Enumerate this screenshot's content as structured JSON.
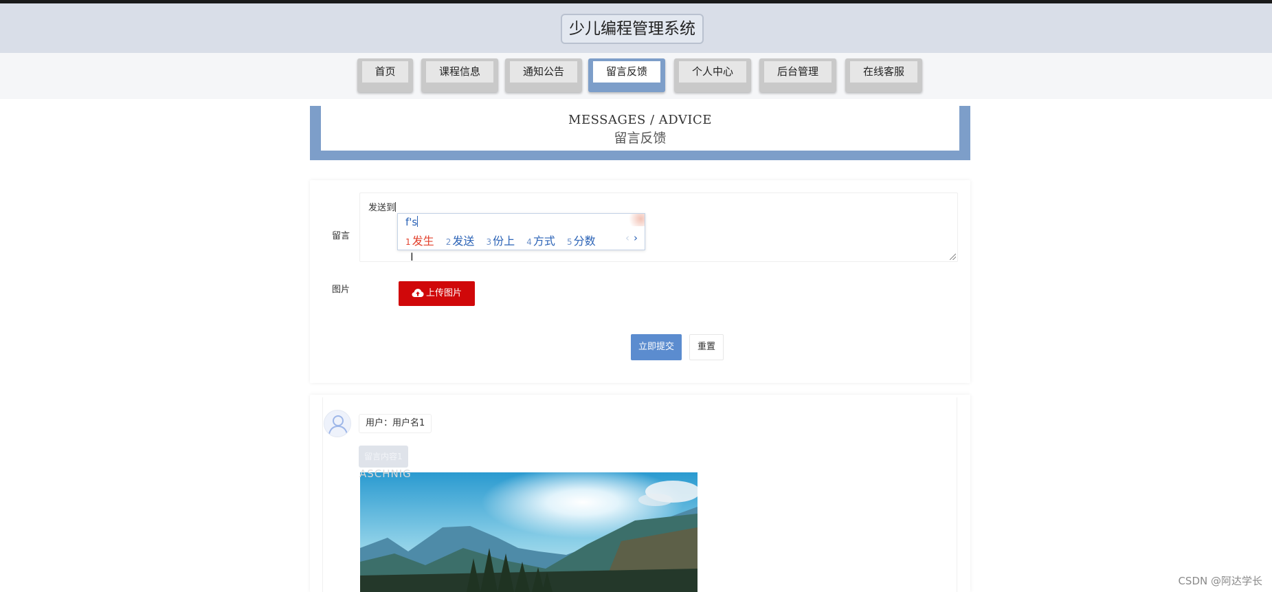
{
  "header": {
    "title": "少儿编程管理系统"
  },
  "nav": {
    "items": [
      {
        "label": "首页",
        "active": false
      },
      {
        "label": "课程信息",
        "active": false
      },
      {
        "label": "通知公告",
        "active": false
      },
      {
        "label": "留言反馈",
        "active": true
      },
      {
        "label": "个人中心",
        "active": false
      },
      {
        "label": "后台管理",
        "active": false
      },
      {
        "label": "在线客服",
        "active": false
      }
    ]
  },
  "banner": {
    "title_en": "MESSAGES / ADVICE",
    "title_cn": "留言反馈"
  },
  "form": {
    "message_label": "留言",
    "message_value": "发送到",
    "image_label": "图片",
    "upload_label": "上传图片",
    "submit_label": "立即提交",
    "reset_label": "重置"
  },
  "ime": {
    "input": "f's",
    "candidates": [
      {
        "num": "1",
        "text": "发生"
      },
      {
        "num": "2",
        "text": "发送"
      },
      {
        "num": "3",
        "text": "份上"
      },
      {
        "num": "4",
        "text": "方式"
      },
      {
        "num": "5",
        "text": "分数"
      }
    ],
    "prev": "‹",
    "next": "›"
  },
  "messages": [
    {
      "user": "用户：用户名1",
      "content": "留言内容1",
      "image_watermark": "ASCHNIG"
    }
  ],
  "watermark": "CSDN @阿达学长",
  "colors": {
    "accent": "#7d9ec9",
    "upload": "#d0080a",
    "submit": "#5b8ccf",
    "ime_highlight": "#e2402c"
  }
}
